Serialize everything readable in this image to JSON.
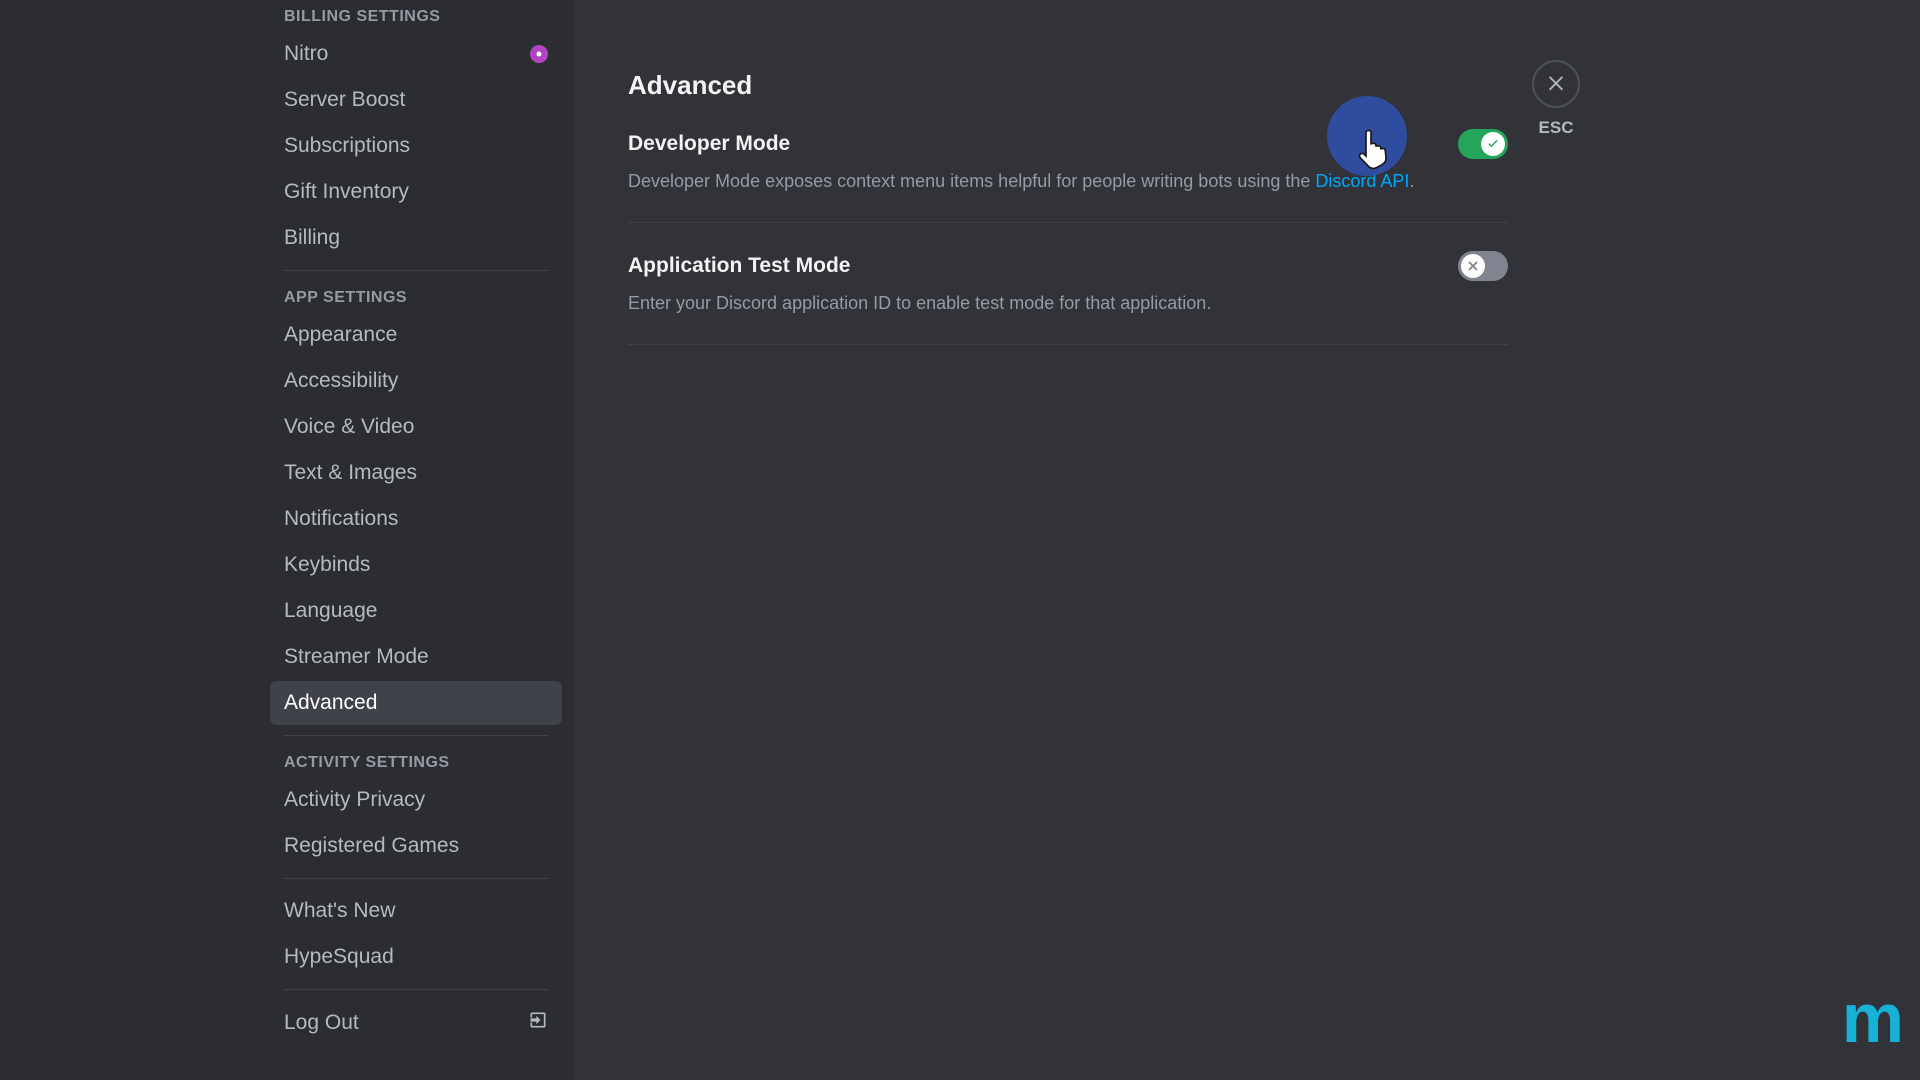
{
  "sidebar": {
    "sections": [
      {
        "header": "BILLING SETTINGS",
        "items": [
          {
            "label": "Nitro",
            "badge": true
          },
          {
            "label": "Server Boost"
          },
          {
            "label": "Subscriptions"
          },
          {
            "label": "Gift Inventory"
          },
          {
            "label": "Billing"
          }
        ]
      },
      {
        "header": "APP SETTINGS",
        "items": [
          {
            "label": "Appearance"
          },
          {
            "label": "Accessibility"
          },
          {
            "label": "Voice & Video"
          },
          {
            "label": "Text & Images"
          },
          {
            "label": "Notifications"
          },
          {
            "label": "Keybinds"
          },
          {
            "label": "Language"
          },
          {
            "label": "Streamer Mode"
          },
          {
            "label": "Advanced",
            "active": true
          }
        ]
      },
      {
        "header": "ACTIVITY SETTINGS",
        "items": [
          {
            "label": "Activity Privacy"
          },
          {
            "label": "Registered Games"
          }
        ]
      }
    ],
    "footer_items": [
      {
        "label": "What's New"
      },
      {
        "label": "HypeSquad"
      }
    ],
    "logout_label": "Log Out"
  },
  "main": {
    "title": "Advanced",
    "settings": [
      {
        "title": "Developer Mode",
        "desc_prefix": "Developer Mode exposes context menu items helpful for people writing bots using the ",
        "desc_link": "Discord API",
        "desc_suffix": ".",
        "enabled": true
      },
      {
        "title": "Application Test Mode",
        "desc": "Enter your Discord application ID to enable test mode for that application.",
        "enabled": false
      }
    ]
  },
  "close": {
    "esc_label": "ESC"
  },
  "watermark": "m"
}
